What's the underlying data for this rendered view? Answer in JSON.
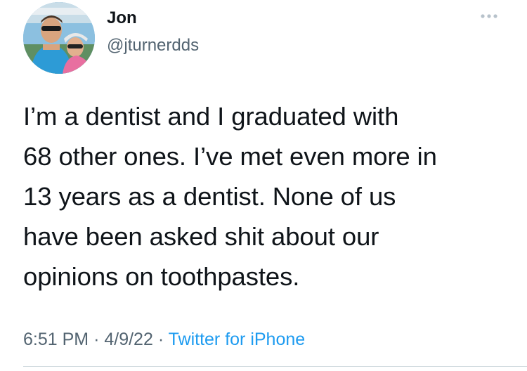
{
  "author": {
    "display_name": "Jon",
    "handle": "@jturnerdds",
    "avatar_icon": "profile-photo"
  },
  "menu": {
    "icon": "more-dots-icon"
  },
  "tweet": {
    "lines": [
      "I’m a dentist and I graduated with",
      "68 other ones. I’ve met even more in",
      "13 years as a dentist. None of us",
      "have been asked shit about our",
      "opinions on toothpastes."
    ]
  },
  "meta": {
    "time": "6:51 PM",
    "separator": "·",
    "date": "4/9/22",
    "source": "Twitter for iPhone"
  },
  "colors": {
    "text": "#0f1419",
    "secondary": "#536471",
    "link": "#1d9bf0",
    "divider": "#cfd9de"
  }
}
